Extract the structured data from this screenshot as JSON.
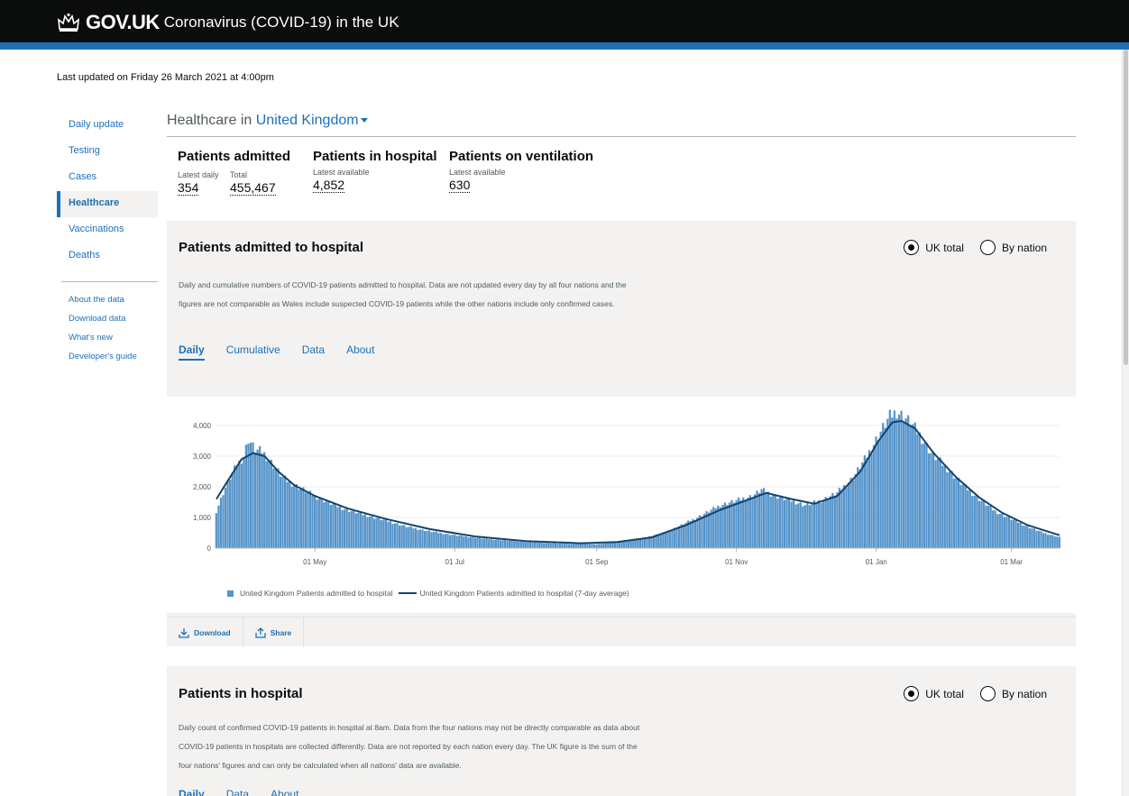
{
  "header": {
    "brand": "GOV.UK",
    "service": "Coronavirus (COVID-19) in the UK",
    "crown_icon": "crown-icon"
  },
  "last_updated": "Last updated on Friday 26 March 2021 at 4:00pm",
  "sidebar": {
    "items": [
      {
        "label": "Daily update",
        "active": false
      },
      {
        "label": "Testing",
        "active": false
      },
      {
        "label": "Cases",
        "active": false
      },
      {
        "label": "Healthcare",
        "active": true
      },
      {
        "label": "Vaccinations",
        "active": false
      },
      {
        "label": "Deaths",
        "active": false
      }
    ],
    "links": [
      "About the data",
      "Download data",
      "What's new",
      "Developer's guide"
    ]
  },
  "page": {
    "heading_prefix": "Healthcare in",
    "location": "United Kingdom"
  },
  "headlines": {
    "admitted": {
      "title": "Patients admitted",
      "daily_label": "Latest daily",
      "daily_value": "354",
      "total_label": "Total",
      "total_value": "455,467"
    },
    "in_hospital": {
      "title": "Patients in hospital",
      "label": "Latest available",
      "value": "4,852"
    },
    "ventilation": {
      "title": "Patients on ventilation",
      "label": "Latest available",
      "value": "630"
    }
  },
  "card1": {
    "title": "Patients admitted to hospital",
    "radio_uk": "UK total",
    "radio_nation": "By nation",
    "description": "Daily and cumulative numbers of COVID-19 patients admitted to hospital. Data are not updated every day by all four nations and the figures are not comparable as Wales include suspected COVID-19 patients while the other nations include only confirmed cases.",
    "tabs": [
      "Daily",
      "Cumulative",
      "Data",
      "About"
    ],
    "legend_bars": "United Kingdom Patients admitted to hospital",
    "legend_line": "United Kingdom Patients admitted to hospital (7-day average)",
    "download": "Download",
    "share": "Share"
  },
  "card2": {
    "title": "Patients in hospital",
    "radio_uk": "UK total",
    "radio_nation": "By nation",
    "description": "Daily count of confirmed COVID-19 patients in hospital at 8am. Data from the four nations may not be directly comparable as data about COVID-19 patients in hospitals are collected differently. Data are not reported by each nation every day. The UK figure is the sum of the four nations' figures and can only be calculated when all nations' data are available.",
    "tabs": [
      "Daily",
      "Data",
      "About"
    ]
  },
  "colors": {
    "header_bg": "#0b0c0c",
    "accent": "#1d70b8",
    "bar": "#5694ca",
    "line": "#12436d",
    "card_bg": "#f3f2f1"
  },
  "chart_data": {
    "type": "bar",
    "title": "Patients admitted to hospital",
    "xlabel": "",
    "ylabel": "",
    "ylim": [
      0,
      4500
    ],
    "y_ticks": [
      "0",
      "1,000",
      "2,000",
      "3,000",
      "4,000"
    ],
    "x_tick_labels": [
      "01 May",
      "01 Jul",
      "01 Sep",
      "01 Nov",
      "01 Jan",
      "01 Mar"
    ],
    "x_tick_dates": [
      "2020-05-01",
      "2020-07-01",
      "2020-09-01",
      "2020-11-01",
      "2021-01-01",
      "2021-03-01"
    ],
    "x_range": [
      "2020-03-19",
      "2021-03-22"
    ],
    "grid": true,
    "legend_position": "bottom",
    "series": [
      {
        "name": "United Kingdom Patients admitted to hospital",
        "kind": "bar",
        "points": [
          [
            "2020-03-19",
            1200
          ],
          [
            "2020-03-22",
            1800
          ],
          [
            "2020-03-25",
            2300
          ],
          [
            "2020-03-28",
            2700
          ],
          [
            "2020-03-31",
            3000
          ],
          [
            "2020-04-02",
            3550
          ],
          [
            "2020-04-05",
            3200
          ],
          [
            "2020-04-08",
            3150
          ],
          [
            "2020-04-11",
            2900
          ],
          [
            "2020-04-14",
            2600
          ],
          [
            "2020-04-17",
            2300
          ],
          [
            "2020-04-20",
            2150
          ],
          [
            "2020-04-25",
            1950
          ],
          [
            "2020-05-01",
            1700
          ],
          [
            "2020-05-08",
            1450
          ],
          [
            "2020-05-15",
            1250
          ],
          [
            "2020-05-22",
            1100
          ],
          [
            "2020-06-01",
            900
          ],
          [
            "2020-06-10",
            700
          ],
          [
            "2020-06-20",
            550
          ],
          [
            "2020-07-01",
            420
          ],
          [
            "2020-07-15",
            300
          ],
          [
            "2020-08-01",
            200
          ],
          [
            "2020-08-20",
            140
          ],
          [
            "2020-09-01",
            130
          ],
          [
            "2020-09-15",
            220
          ],
          [
            "2020-10-01",
            500
          ],
          [
            "2020-10-15",
            1000
          ],
          [
            "2020-10-25",
            1400
          ],
          [
            "2020-11-01",
            1550
          ],
          [
            "2020-11-08",
            1700
          ],
          [
            "2020-11-12",
            1900
          ],
          [
            "2020-11-18",
            1700
          ],
          [
            "2020-11-25",
            1550
          ],
          [
            "2020-12-01",
            1400
          ],
          [
            "2020-12-08",
            1550
          ],
          [
            "2020-12-15",
            1800
          ],
          [
            "2020-12-22",
            2300
          ],
          [
            "2020-12-28",
            3000
          ],
          [
            "2021-01-03",
            3800
          ],
          [
            "2021-01-07",
            4300
          ],
          [
            "2021-01-10",
            4450
          ],
          [
            "2021-01-13",
            4300
          ],
          [
            "2021-01-16",
            4100
          ],
          [
            "2021-01-20",
            3700
          ],
          [
            "2021-01-25",
            3100
          ],
          [
            "2021-02-01",
            2600
          ],
          [
            "2021-02-08",
            2050
          ],
          [
            "2021-02-15",
            1600
          ],
          [
            "2021-02-22",
            1200
          ],
          [
            "2021-03-01",
            950
          ],
          [
            "2021-03-08",
            700
          ],
          [
            "2021-03-15",
            500
          ],
          [
            "2021-03-22",
            354
          ]
        ]
      },
      {
        "name": "United Kingdom Patients admitted to hospital (7-day average)",
        "kind": "line",
        "points": [
          [
            "2020-03-19",
            1600
          ],
          [
            "2020-03-24",
            2200
          ],
          [
            "2020-03-30",
            2900
          ],
          [
            "2020-04-04",
            3100
          ],
          [
            "2020-04-09",
            3000
          ],
          [
            "2020-04-15",
            2500
          ],
          [
            "2020-04-22",
            2050
          ],
          [
            "2020-05-01",
            1700
          ],
          [
            "2020-05-15",
            1300
          ],
          [
            "2020-06-01",
            950
          ],
          [
            "2020-06-20",
            620
          ],
          [
            "2020-07-10",
            380
          ],
          [
            "2020-08-01",
            230
          ],
          [
            "2020-08-25",
            160
          ],
          [
            "2020-09-10",
            200
          ],
          [
            "2020-09-25",
            350
          ],
          [
            "2020-10-10",
            750
          ],
          [
            "2020-10-25",
            1250
          ],
          [
            "2020-11-05",
            1550
          ],
          [
            "2020-11-14",
            1800
          ],
          [
            "2020-11-25",
            1600
          ],
          [
            "2020-12-05",
            1450
          ],
          [
            "2020-12-15",
            1700
          ],
          [
            "2020-12-25",
            2500
          ],
          [
            "2021-01-02",
            3500
          ],
          [
            "2021-01-08",
            4100
          ],
          [
            "2021-01-12",
            4150
          ],
          [
            "2021-01-18",
            3900
          ],
          [
            "2021-01-26",
            3100
          ],
          [
            "2021-02-05",
            2300
          ],
          [
            "2021-02-15",
            1650
          ],
          [
            "2021-02-25",
            1150
          ],
          [
            "2021-03-08",
            750
          ],
          [
            "2021-03-22",
            420
          ]
        ]
      }
    ]
  }
}
